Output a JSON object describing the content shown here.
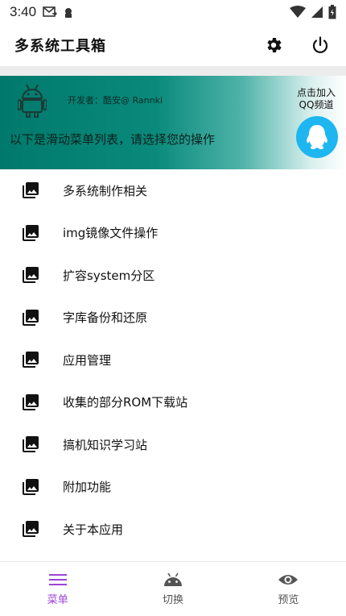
{
  "status_bar": {
    "time": "3:40"
  },
  "app_bar": {
    "title": "多系统工具箱"
  },
  "banner": {
    "developer": "开发者：酷安@ Rannki",
    "instruction": "以下是滑动菜单列表，请选择您的操作",
    "qq_line1": "点击加入",
    "qq_line2": "QQ频道"
  },
  "menu": {
    "items": [
      {
        "label": "多系统制作相关"
      },
      {
        "label": "img镜像文件操作"
      },
      {
        "label": "扩容system分区"
      },
      {
        "label": "字库备份和还原"
      },
      {
        "label": "应用管理"
      },
      {
        "label": "收集的部分ROM下载站"
      },
      {
        "label": "搞机知识学习站"
      },
      {
        "label": "附加功能"
      },
      {
        "label": "关于本应用"
      }
    ]
  },
  "bottom_nav": {
    "tabs": [
      {
        "label": "菜单",
        "icon": "menu-icon",
        "active": true
      },
      {
        "label": "切换",
        "icon": "android-icon",
        "active": false
      },
      {
        "label": "预览",
        "icon": "eye-icon",
        "active": false
      }
    ]
  },
  "colors": {
    "accent": "#9c44dc",
    "banner_start": "#00796b",
    "qq_blue": "#1eb6f0"
  }
}
